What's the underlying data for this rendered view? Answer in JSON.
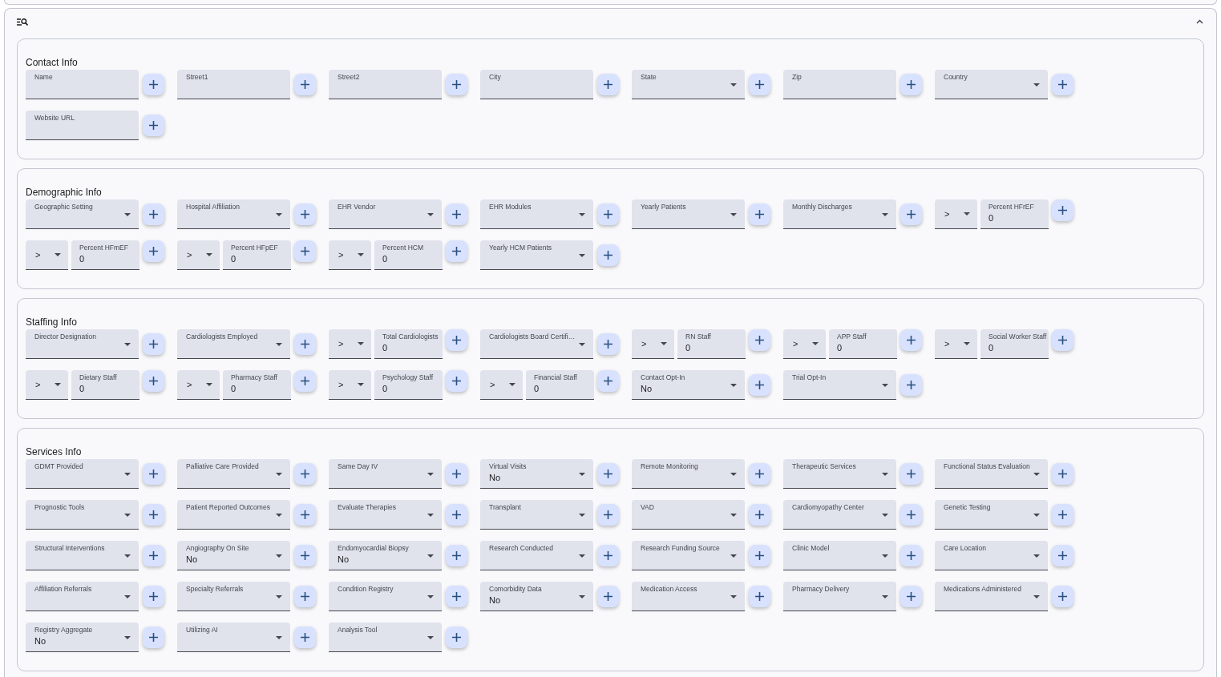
{
  "panel": {
    "expanded": true
  },
  "sections": [
    {
      "title": "Contact Info",
      "fields": [
        {
          "kind": "text",
          "label": "Name"
        },
        {
          "kind": "text",
          "label": "Street1"
        },
        {
          "kind": "text",
          "label": "Street2"
        },
        {
          "kind": "text",
          "label": "City"
        },
        {
          "kind": "select",
          "label": "State"
        },
        {
          "kind": "text",
          "label": "Zip"
        },
        {
          "kind": "select",
          "label": "Country"
        },
        {
          "kind": "text",
          "label": "Website URL"
        }
      ]
    },
    {
      "title": "Demographic Info",
      "fields": [
        {
          "kind": "select",
          "label": "Geographic Setting"
        },
        {
          "kind": "select",
          "label": "Hospital Affiliation"
        },
        {
          "kind": "select",
          "label": "EHR Vendor"
        },
        {
          "kind": "select",
          "label": "EHR Modules"
        },
        {
          "kind": "select",
          "label": "Yearly Patients"
        },
        {
          "kind": "select",
          "label": "Monthly Discharges"
        },
        {
          "kind": "compare",
          "operator": ">",
          "label": "Percent HFrEF",
          "value": "0"
        },
        {
          "kind": "compare",
          "operator": ">",
          "label": "Percent HFmEF",
          "value": "0"
        },
        {
          "kind": "compare",
          "operator": ">",
          "label": "Percent HFpEF",
          "value": "0"
        },
        {
          "kind": "compare",
          "operator": ">",
          "label": "Percent HCM",
          "value": "0"
        },
        {
          "kind": "select",
          "label": "Yearly HCM Patients"
        }
      ]
    },
    {
      "title": "Staffing Info",
      "fields": [
        {
          "kind": "select",
          "label": "Director Designation"
        },
        {
          "kind": "select",
          "label": "Cardiologists Employed"
        },
        {
          "kind": "compare",
          "operator": ">",
          "label": "Total Cardiologists",
          "value": "0"
        },
        {
          "kind": "select",
          "label": "Cardiologists Board Certifi…"
        },
        {
          "kind": "compare",
          "operator": ">",
          "label": "RN Staff",
          "value": "0"
        },
        {
          "kind": "compare",
          "operator": ">",
          "label": "APP Staff",
          "value": "0"
        },
        {
          "kind": "compare",
          "operator": ">",
          "label": "Social Worker Staff",
          "value": "0"
        },
        {
          "kind": "compare",
          "operator": ">",
          "label": "Dietary Staff",
          "value": "0"
        },
        {
          "kind": "compare",
          "operator": ">",
          "label": "Pharmacy Staff",
          "value": "0"
        },
        {
          "kind": "compare",
          "operator": ">",
          "label": "Psychology Staff",
          "value": "0"
        },
        {
          "kind": "compare",
          "operator": ">",
          "label": "Financial Staff",
          "value": "0"
        },
        {
          "kind": "select",
          "label": "Contact Opt-In",
          "value": "No"
        },
        {
          "kind": "select",
          "label": "Trial Opt-In"
        }
      ]
    },
    {
      "title": "Services Info",
      "fields": [
        {
          "kind": "select",
          "label": "GDMT Provided"
        },
        {
          "kind": "select",
          "label": "Palliative Care Provided"
        },
        {
          "kind": "select",
          "label": "Same Day IV"
        },
        {
          "kind": "select",
          "label": "Virtual Visits",
          "value": "No"
        },
        {
          "kind": "select",
          "label": "Remote Monitoring"
        },
        {
          "kind": "select",
          "label": "Therapeutic Services"
        },
        {
          "kind": "select",
          "label": "Functional Status Evaluation"
        },
        {
          "kind": "select",
          "label": "Prognostic Tools"
        },
        {
          "kind": "select",
          "label": "Patient Reported Outcomes"
        },
        {
          "kind": "select",
          "label": "Evaluate Therapies"
        },
        {
          "kind": "select",
          "label": "Transplant"
        },
        {
          "kind": "select",
          "label": "VAD"
        },
        {
          "kind": "select",
          "label": "Cardiomyopathy Center"
        },
        {
          "kind": "select",
          "label": "Genetic Testing"
        },
        {
          "kind": "select",
          "label": "Structural Interventions"
        },
        {
          "kind": "select",
          "label": "Angiography On Site",
          "value": "No"
        },
        {
          "kind": "select",
          "label": "Endomyocardial Biopsy",
          "value": "No"
        },
        {
          "kind": "select",
          "label": "Research Conducted"
        },
        {
          "kind": "select",
          "label": "Research Funding Source"
        },
        {
          "kind": "select",
          "label": "Clinic Model"
        },
        {
          "kind": "select",
          "label": "Care Location"
        },
        {
          "kind": "select",
          "label": "Affiliation Referrals"
        },
        {
          "kind": "select",
          "label": "Specialty Referrals"
        },
        {
          "kind": "select",
          "label": "Condition Registry"
        },
        {
          "kind": "select",
          "label": "Comorbidity Data",
          "value": "No"
        },
        {
          "kind": "select",
          "label": "Medication Access"
        },
        {
          "kind": "select",
          "label": "Pharmacy Delivery"
        },
        {
          "kind": "select",
          "label": "Medications Administered"
        },
        {
          "kind": "select",
          "label": "Registry Aggregate",
          "value": "No"
        },
        {
          "kind": "select",
          "label": "Utilizing AI"
        },
        {
          "kind": "select",
          "label": "Analysis Tool"
        }
      ]
    }
  ]
}
